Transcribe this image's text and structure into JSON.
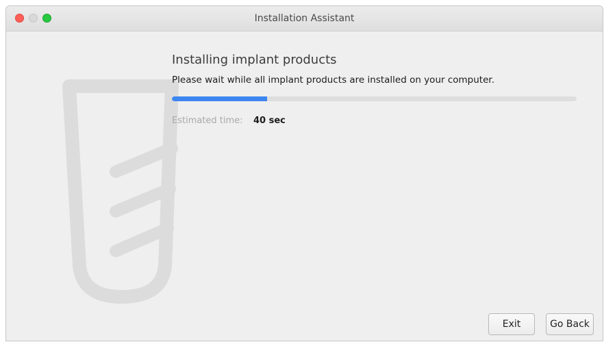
{
  "window": {
    "title": "Installation Assistant"
  },
  "content": {
    "heading": "Installing implant products",
    "subheading": "Please wait while all implant products are installed on your computer.",
    "progress_fraction": 0.235,
    "estimated_time_label": "Estimated time:",
    "estimated_time_value": "40 sec"
  },
  "footer": {
    "exit_label": "Exit",
    "go_back_label": "Go Back"
  },
  "icons": {
    "watermark": "implant-icon"
  },
  "colors": {
    "progress_fill": "#3d86f0",
    "progress_track": "#dedede",
    "window_bg": "#efefef",
    "close": "#fe5f57",
    "maximize": "#28c840"
  }
}
